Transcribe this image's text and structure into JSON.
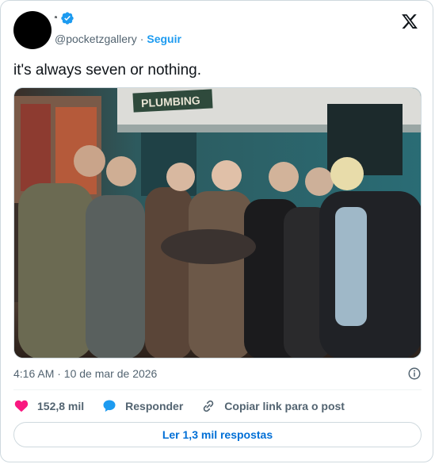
{
  "author": {
    "display_name": "ᵃ",
    "handle": "@pocketzgallery",
    "separator": "·",
    "follow_label": "Seguir"
  },
  "tweet": {
    "text": "it's always seven or nothing.",
    "image_sign_text": "PLUMBING",
    "timestamp": "4:16 AM · 10 de mar de 2026"
  },
  "actions": {
    "likes": "152,8 mil",
    "reply_label": "Responder",
    "copy_link_label": "Copiar link para o post"
  },
  "replies_button": "Ler 1,3 mil respostas",
  "colors": {
    "accent": "#1d9bf0",
    "like": "#f91880",
    "muted": "#536471"
  },
  "icons": [
    "verified-badge-icon",
    "x-logo-icon",
    "info-icon",
    "heart-icon",
    "reply-bubble-icon",
    "link-icon"
  ]
}
